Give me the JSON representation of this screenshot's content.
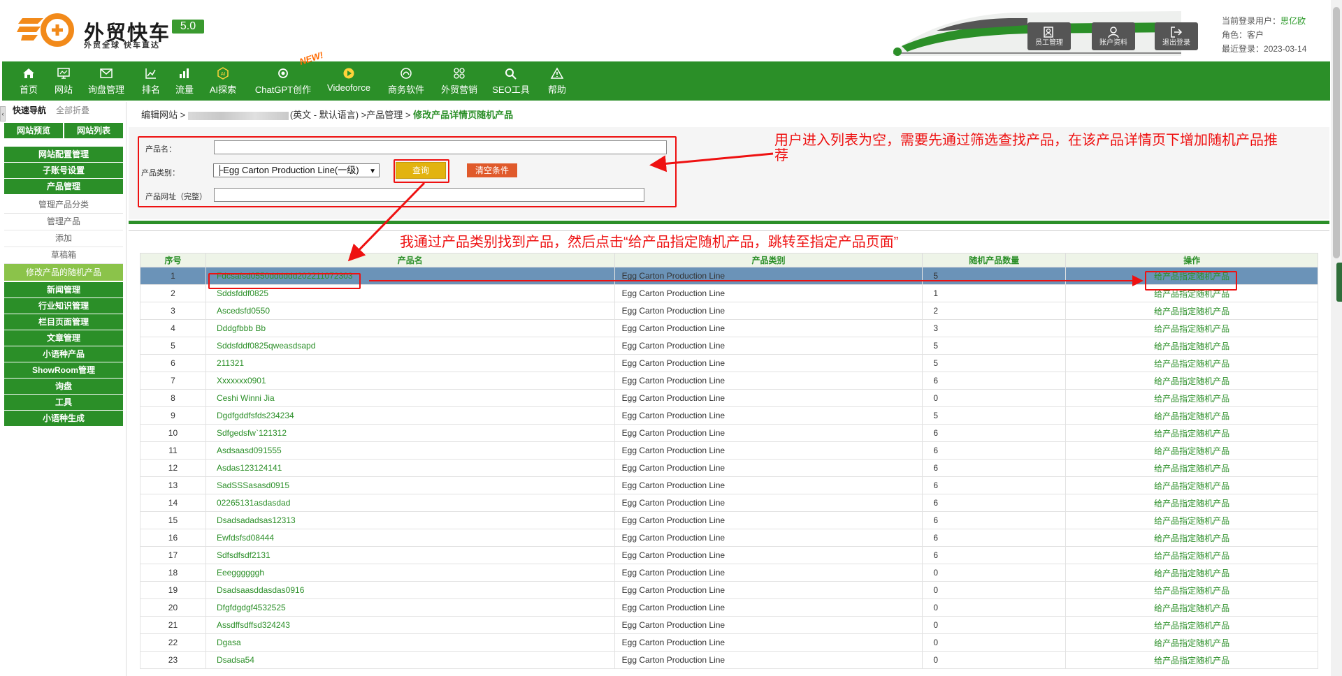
{
  "header": {
    "brand_name": "外贸快车",
    "brand_version": "5.0",
    "brand_slogan": "外贸全球 快车直达",
    "buttons": [
      {
        "label": "员工管理",
        "icon": "staff-icon"
      },
      {
        "label": "账户资料",
        "icon": "account-icon"
      },
      {
        "label": "退出登录",
        "icon": "logout-icon"
      }
    ],
    "login": {
      "user_label": "当前登录用户：",
      "user_name": "思亿欧",
      "role_label": "角色：",
      "role": "客户",
      "last_login_label": "最近登录：",
      "last_login": "2023-03-14"
    }
  },
  "nav": {
    "items": [
      {
        "label": "首页",
        "icon": "home-icon"
      },
      {
        "label": "网站",
        "icon": "monitor-icon"
      },
      {
        "label": "询盘管理",
        "icon": "mail-icon"
      },
      {
        "label": "排名",
        "icon": "ranking-icon"
      },
      {
        "label": "流量",
        "icon": "bar-chart-icon"
      },
      {
        "label": "AI探索",
        "icon": "ai-icon"
      },
      {
        "label": "ChatGPT创作",
        "icon": "chatgpt-icon"
      },
      {
        "label": "Videoforce",
        "icon": "video-icon"
      },
      {
        "label": "商务软件",
        "icon": "software-icon"
      },
      {
        "label": "外贸营销",
        "icon": "marketing-icon"
      },
      {
        "label": "SEO工具",
        "icon": "search-icon"
      },
      {
        "label": "帮助",
        "icon": "warning-icon"
      }
    ],
    "new_badge": "NEW!"
  },
  "sidebar": {
    "quick_nav": "快速导航",
    "collapse_all": "全部折叠",
    "collapse_tab": "‹",
    "preview": "网站预览",
    "site_list": "网站列表",
    "items": [
      {
        "label": "网站配置管理",
        "type": "main"
      },
      {
        "label": "子账号设置",
        "type": "main"
      },
      {
        "label": "产品管理",
        "type": "main"
      },
      {
        "label": "管理产品分类",
        "type": "sub"
      },
      {
        "label": "管理产品",
        "type": "sub"
      },
      {
        "label": "添加",
        "type": "sub"
      },
      {
        "label": "草稿箱",
        "type": "sub"
      },
      {
        "label": "修改产品的随机产品",
        "type": "active"
      },
      {
        "label": "新闻管理",
        "type": "main"
      },
      {
        "label": "行业知识管理",
        "type": "main"
      },
      {
        "label": "栏目页面管理",
        "type": "main"
      },
      {
        "label": "文章管理",
        "type": "main"
      },
      {
        "label": "小语种产品",
        "type": "main"
      },
      {
        "label": "ShowRoom管理",
        "type": "main"
      },
      {
        "label": "询盘",
        "type": "main"
      },
      {
        "label": "工具",
        "type": "main"
      },
      {
        "label": "小语种生成",
        "type": "main"
      }
    ]
  },
  "breadcrumb": {
    "part1": "编辑网站 >",
    "part2": "(英文 - 默认语言) >产品管理 >",
    "current": "修改产品详情页随机产品"
  },
  "filter": {
    "name_label": "产品名：",
    "category_label": "产品类别：",
    "category_value": "├Egg Carton Production Line(一级)",
    "url_label": "产品网址（完整）",
    "query_button": "查询",
    "clear_button": "清空条件"
  },
  "table": {
    "columns": [
      "序号",
      "产品名",
      "产品类别",
      "随机产品数量",
      "操作"
    ],
    "action_text": "给产品指定随机产品",
    "rows": [
      [
        "1",
        "Fdcsafsd0550dddddd202211072303",
        "Egg Carton Production Line",
        "5"
      ],
      [
        "2",
        "Sddsfddf0825",
        "Egg Carton Production Line",
        "1"
      ],
      [
        "3",
        "Ascedsfd0550",
        "Egg Carton Production Line",
        "2"
      ],
      [
        "4",
        "Dddgfbbb Bb",
        "Egg Carton Production Line",
        "3"
      ],
      [
        "5",
        "Sddsfddf0825qweasdsapd",
        "Egg Carton Production Line",
        "5"
      ],
      [
        "6",
        "211321",
        "Egg Carton Production Line",
        "5"
      ],
      [
        "7",
        "Xxxxxxx0901",
        "Egg Carton Production Line",
        "6"
      ],
      [
        "8",
        "Ceshi Winni Jia",
        "Egg Carton Production Line",
        "0"
      ],
      [
        "9",
        "Dgdfgddfsfds234234",
        "Egg Carton Production Line",
        "5"
      ],
      [
        "10",
        "Sdfgedsfw`121312",
        "Egg Carton Production Line",
        "6"
      ],
      [
        "11",
        "Asdsaasd091555",
        "Egg Carton Production Line",
        "6"
      ],
      [
        "12",
        "Asdas123124141",
        "Egg Carton Production Line",
        "6"
      ],
      [
        "13",
        "SadSSSasasd0915",
        "Egg Carton Production Line",
        "6"
      ],
      [
        "14",
        "02265131asdasdad",
        "Egg Carton Production Line",
        "6"
      ],
      [
        "15",
        "Dsadsadadsas12313",
        "Egg Carton Production Line",
        "6"
      ],
      [
        "16",
        "Ewfdsfsd08444",
        "Egg Carton Production Line",
        "6"
      ],
      [
        "17",
        "Sdfsdfsdf2131",
        "Egg Carton Production Line",
        "6"
      ],
      [
        "18",
        "Eeeggggggh",
        "Egg Carton Production Line",
        "0"
      ],
      [
        "19",
        "Dsadsaasddasdas0916",
        "Egg Carton Production Line",
        "0"
      ],
      [
        "20",
        "Dfgfdgdgf4532525",
        "Egg Carton Production Line",
        "0"
      ],
      [
        "21",
        "Assdffsdffsd324243",
        "Egg Carton Production Line",
        "0"
      ],
      [
        "22",
        "Dgasa",
        "Egg Carton Production Line",
        "0"
      ],
      [
        "23",
        "Dsadsa54",
        "Egg Carton Production Line",
        "0"
      ]
    ]
  },
  "annotations": {
    "note1_line1": "用户进入列表为空，需要先通过筛选查找产品，在该产品详情页下增加随机产品推",
    "note1_line2": "荐",
    "note2": "我通过产品类别找到产品，然后点击“给产品指定随机产品，跳转至指定产品页面”"
  },
  "colors": {
    "brand_green": "#2b8f28",
    "highlight_row": "#6b93b8",
    "annotation_red": "#e11111",
    "query_yellow": "#e2b30f",
    "clear_orange": "#e05a2b"
  }
}
